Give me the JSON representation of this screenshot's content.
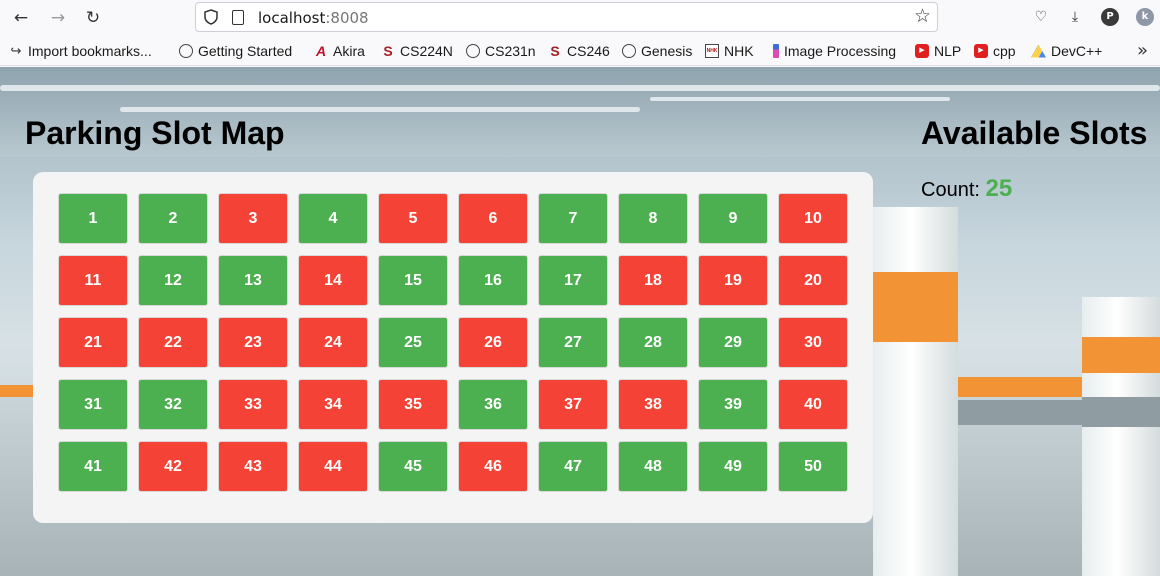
{
  "browser": {
    "url_host": "localhost",
    "url_port": ":8008",
    "profile_initial": "P",
    "extension_initial": "k",
    "bookmarks": [
      {
        "label": "Import bookmarks...",
        "icon": "import-icon"
      },
      {
        "label": "Getting Started",
        "icon": "globe-icon"
      },
      {
        "label": "Akira",
        "icon": "akira-icon"
      },
      {
        "label": "CS224N",
        "icon": "stanford-icon"
      },
      {
        "label": "CS231n",
        "icon": "globe-icon"
      },
      {
        "label": "CS246",
        "icon": "stanford-icon"
      },
      {
        "label": "Genesis",
        "icon": "globe-icon"
      },
      {
        "label": "NHK",
        "icon": "nhk-icon"
      },
      {
        "label": "Image Processing",
        "icon": "image-processing-icon"
      },
      {
        "label": "NLP",
        "icon": "youtube-icon"
      },
      {
        "label": "cpp",
        "icon": "youtube-icon"
      },
      {
        "label": "DevC++",
        "icon": "google-drive-icon"
      }
    ]
  },
  "page": {
    "title": "Parking Slot Map",
    "available_title": "Available Slots",
    "count_label": "Count:",
    "count_value": "25"
  },
  "colors": {
    "available": "#4caf50",
    "occupied": "#f44336",
    "count": "#4caf50"
  },
  "slots": [
    {
      "number": "1",
      "status": "available"
    },
    {
      "number": "2",
      "status": "available"
    },
    {
      "number": "3",
      "status": "occupied"
    },
    {
      "number": "4",
      "status": "available"
    },
    {
      "number": "5",
      "status": "occupied"
    },
    {
      "number": "6",
      "status": "occupied"
    },
    {
      "number": "7",
      "status": "available"
    },
    {
      "number": "8",
      "status": "available"
    },
    {
      "number": "9",
      "status": "available"
    },
    {
      "number": "10",
      "status": "occupied"
    },
    {
      "number": "11",
      "status": "occupied"
    },
    {
      "number": "12",
      "status": "available"
    },
    {
      "number": "13",
      "status": "available"
    },
    {
      "number": "14",
      "status": "occupied"
    },
    {
      "number": "15",
      "status": "available"
    },
    {
      "number": "16",
      "status": "available"
    },
    {
      "number": "17",
      "status": "available"
    },
    {
      "number": "18",
      "status": "occupied"
    },
    {
      "number": "19",
      "status": "occupied"
    },
    {
      "number": "20",
      "status": "occupied"
    },
    {
      "number": "21",
      "status": "occupied"
    },
    {
      "number": "22",
      "status": "occupied"
    },
    {
      "number": "23",
      "status": "occupied"
    },
    {
      "number": "24",
      "status": "occupied"
    },
    {
      "number": "25",
      "status": "available"
    },
    {
      "number": "26",
      "status": "occupied"
    },
    {
      "number": "27",
      "status": "available"
    },
    {
      "number": "28",
      "status": "available"
    },
    {
      "number": "29",
      "status": "available"
    },
    {
      "number": "30",
      "status": "occupied"
    },
    {
      "number": "31",
      "status": "available"
    },
    {
      "number": "32",
      "status": "available"
    },
    {
      "number": "33",
      "status": "occupied"
    },
    {
      "number": "34",
      "status": "occupied"
    },
    {
      "number": "35",
      "status": "occupied"
    },
    {
      "number": "36",
      "status": "available"
    },
    {
      "number": "37",
      "status": "occupied"
    },
    {
      "number": "38",
      "status": "occupied"
    },
    {
      "number": "39",
      "status": "available"
    },
    {
      "number": "40",
      "status": "occupied"
    },
    {
      "number": "41",
      "status": "available"
    },
    {
      "number": "42",
      "status": "occupied"
    },
    {
      "number": "43",
      "status": "occupied"
    },
    {
      "number": "44",
      "status": "occupied"
    },
    {
      "number": "45",
      "status": "available"
    },
    {
      "number": "46",
      "status": "occupied"
    },
    {
      "number": "47",
      "status": "available"
    },
    {
      "number": "48",
      "status": "available"
    },
    {
      "number": "49",
      "status": "available"
    },
    {
      "number": "50",
      "status": "available"
    }
  ]
}
